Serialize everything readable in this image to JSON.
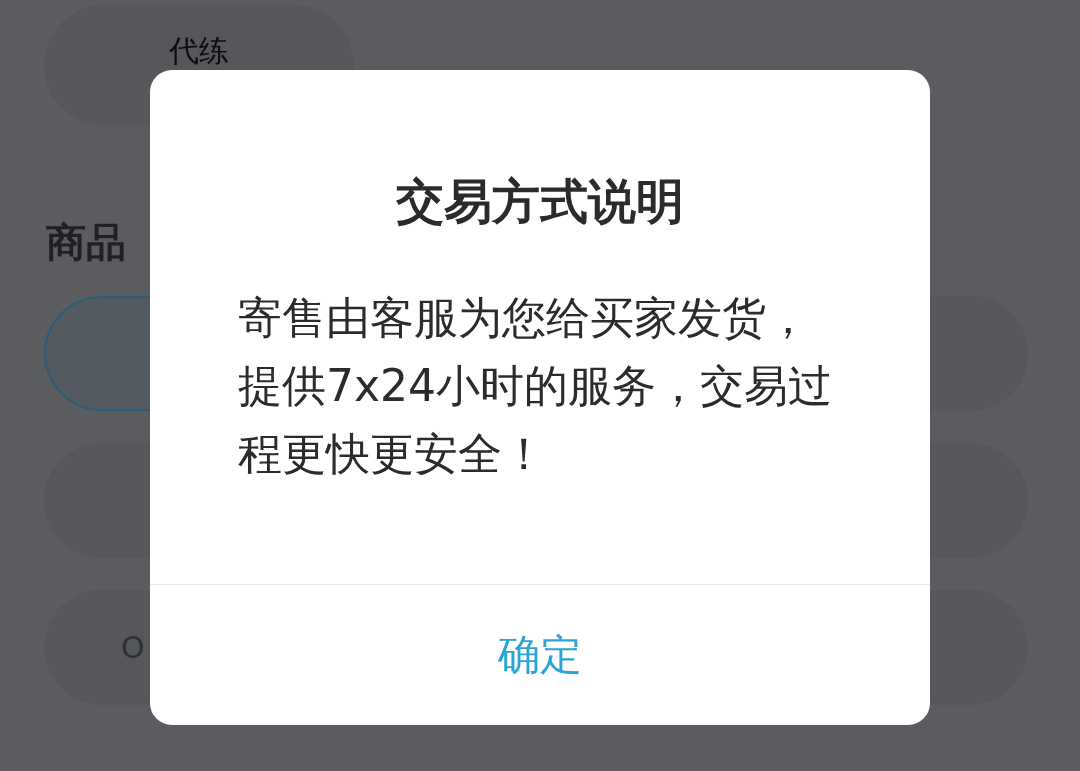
{
  "background": {
    "top_chips": [
      {
        "label": "代练"
      }
    ],
    "section_title": "商品",
    "left_chips": [
      {
        "selected": true
      },
      {
        "selected": false
      },
      {
        "selected": false,
        "label": "O"
      }
    ],
    "right_chips": [
      {
        "selected": false
      },
      {
        "selected": false
      },
      {
        "selected": false
      }
    ]
  },
  "dialog": {
    "title": "交易方式说明",
    "message": "寄售由客服为您给买家发货，提供7x24小时的服务，交易过程更快更安全！",
    "buttons": [
      "确定"
    ]
  }
}
